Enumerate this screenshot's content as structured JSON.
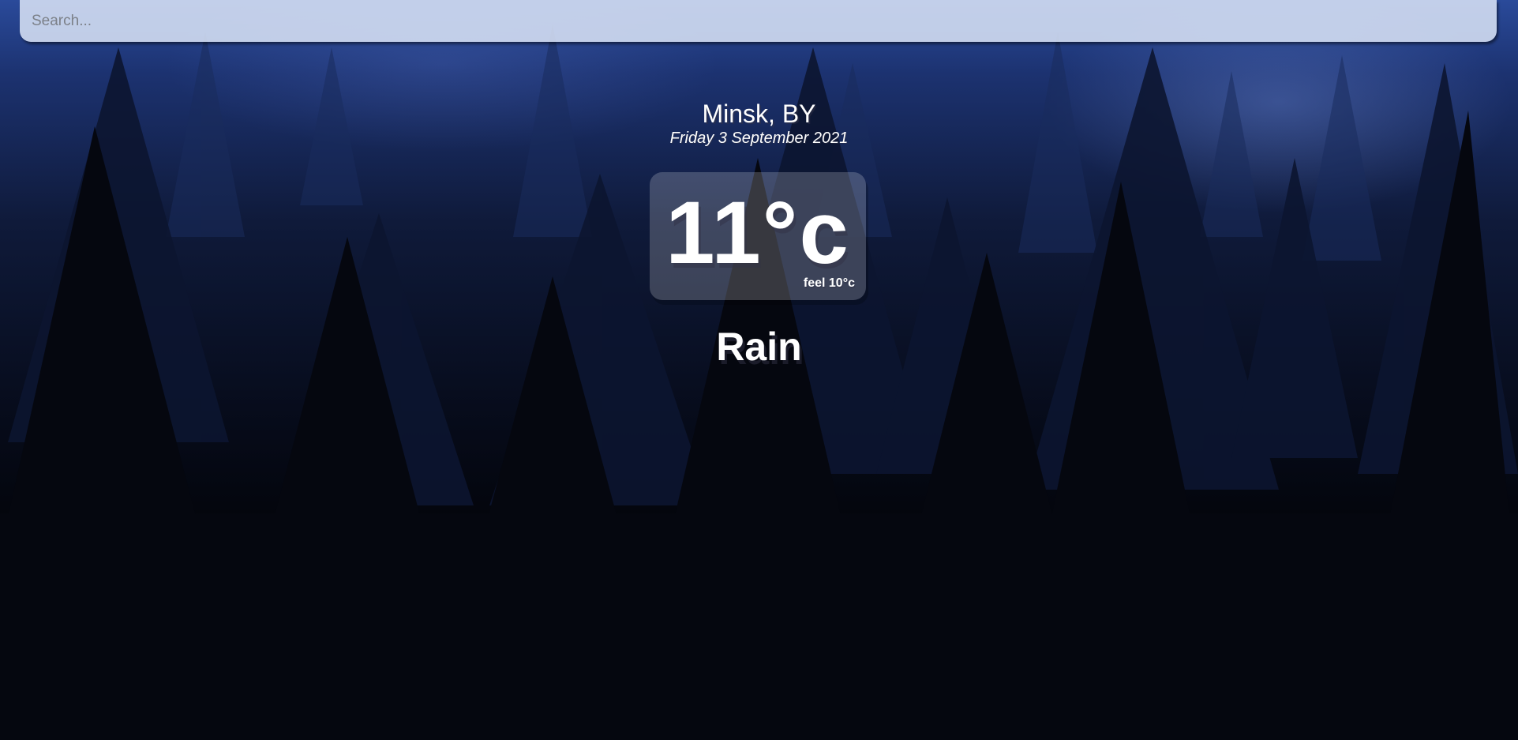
{
  "search": {
    "placeholder": "Search...",
    "value": ""
  },
  "location": {
    "city_country": "Minsk, BY",
    "date": "Friday 3 September 2021"
  },
  "current": {
    "temperature": "11°c",
    "feels_like": "feel 10°c",
    "condition": "Rain"
  },
  "colors": {
    "sky_top": "#2a4a9a",
    "sky_bottom": "#000000",
    "search_bg": "#d7e1f5",
    "text": "#ffffff"
  }
}
